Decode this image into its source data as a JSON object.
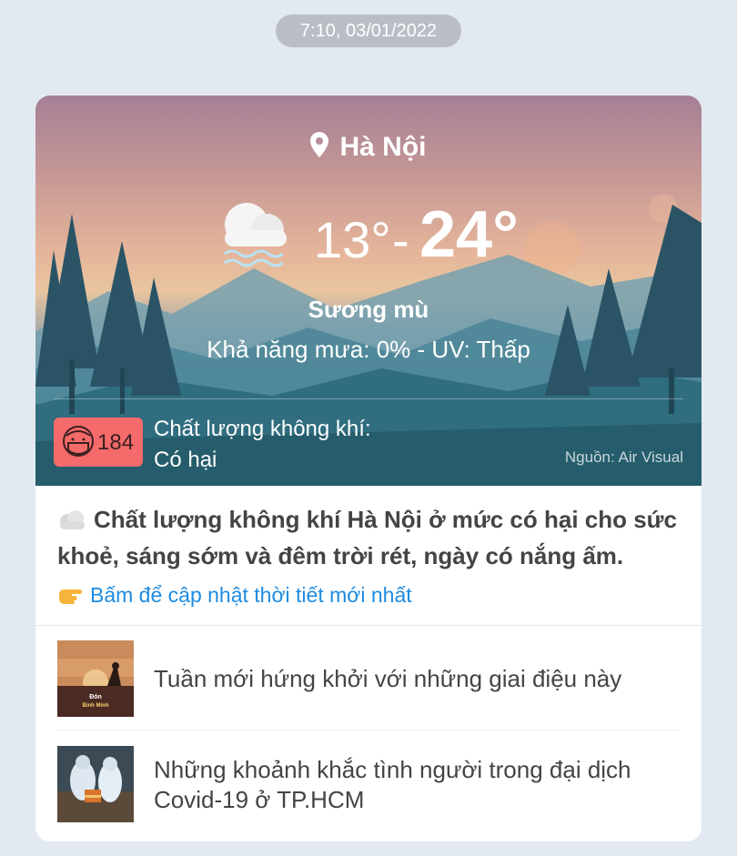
{
  "timestamp": "7:10, 03/01/2022",
  "weather": {
    "city": "Hà Nội",
    "temp_min": "13°",
    "separator": "-",
    "temp_max": "24°",
    "condition": "Sương mù",
    "rain_uv": "Khả năng mưa: 0% - UV: Thấp",
    "icon": "fog-icon"
  },
  "air_quality": {
    "value": "184",
    "label_line1": "Chất lượng không khí:",
    "label_line2": "Có hại",
    "source": "Nguồn: Air Visual",
    "badge_color": "#f56a6a"
  },
  "summary": "Chất lượng không khí Hà Nội ở mức có hại cho sức khoẻ, sáng sớm và đêm trời rét, ngày có nắng ấm.",
  "update_link": "Bấm để cập nhật thời tiết mới nhất",
  "news": [
    {
      "title": "Tuần mới hứng khởi với những giai điệu này",
      "thumb_text_1": "Đón",
      "thumb_text_2": "Bình Minh"
    },
    {
      "title": "Những khoảnh khắc tình người trong đại dịch Covid-19 ở TP.HCM"
    }
  ],
  "colors": {
    "link": "#1e8be0",
    "background": "#e3e9f1"
  }
}
